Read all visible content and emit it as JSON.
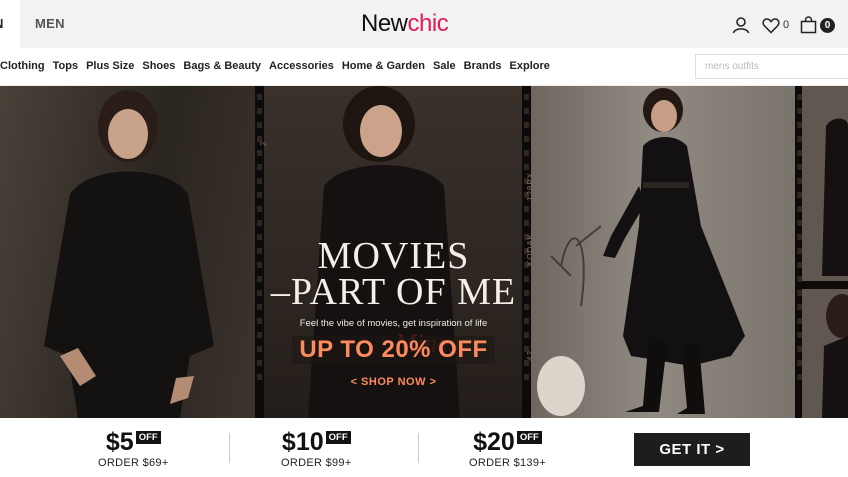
{
  "header": {
    "gender_active": "N",
    "gender_men": "MEN",
    "logo_part1": "New",
    "logo_part2": "chic",
    "wishlist_count": "0",
    "cart_count": "0"
  },
  "nav": {
    "items": [
      "Clothing",
      "Tops",
      "Plus Size",
      "Shoes",
      "Bags & Beauty",
      "Accessories",
      "Home & Garden",
      "Sale",
      "Brands",
      "Explore"
    ]
  },
  "search": {
    "placeholder": "mens outfits"
  },
  "hero": {
    "title_line1": "MOVIES",
    "title_line2": "PART OF ME",
    "script": "Mines",
    "subtitle": "Feel the vibe of movies, get inspiration of life",
    "offer": "UP TO 20% OFF",
    "cta": "< SHOP NOW >",
    "film_labels": [
      "2",
      "KODAK",
      "128PX",
      "42"
    ]
  },
  "deals": [
    {
      "amount": "$5",
      "badge": "OFF",
      "order": "ORDER $69+"
    },
    {
      "amount": "$10",
      "badge": "OFF",
      "order": "ORDER $99+"
    },
    {
      "amount": "$20",
      "badge": "OFF",
      "order": "ORDER $139+"
    }
  ],
  "get_it": "GET IT >",
  "colors": {
    "brand": "#e4185d",
    "offer": "#ff8a5e"
  }
}
